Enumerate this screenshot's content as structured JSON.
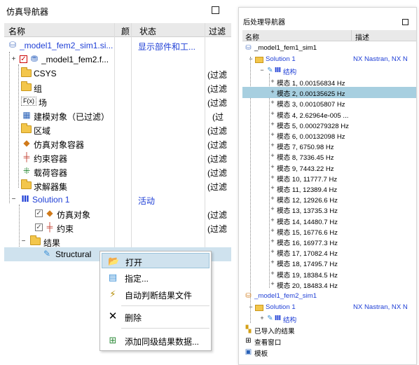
{
  "left": {
    "title": "仿真导航器",
    "columns": [
      "名称",
      "颜",
      "状态",
      "过滤"
    ],
    "rows": [
      {
        "name": "_model1_fem2_sim1.si...",
        "status": "显示部件和工...",
        "filter": ""
      },
      {
        "name": "_model1_fem2.f...",
        "status": "",
        "filter": ""
      },
      {
        "name": "CSYS",
        "status": "",
        "filter": "(过滤"
      },
      {
        "name": "组",
        "status": "",
        "filter": "(过滤"
      },
      {
        "name": "场",
        "status": "",
        "filter": "(过滤"
      },
      {
        "name": "建模对象（已过滤）",
        "status": "",
        "filter": "(过"
      },
      {
        "name": "区域",
        "status": "",
        "filter": "(过滤"
      },
      {
        "name": "仿真对象容器",
        "status": "",
        "filter": "(过滤"
      },
      {
        "name": "约束容器",
        "status": "",
        "filter": "(过滤"
      },
      {
        "name": "载荷容器",
        "status": "",
        "filter": "(过滤"
      },
      {
        "name": "求解器集",
        "status": "",
        "filter": "(过滤"
      },
      {
        "name": "Solution 1",
        "status": "活动",
        "filter": ""
      },
      {
        "name": "仿真对象",
        "status": "",
        "filter": "(过滤"
      },
      {
        "name": "约束",
        "status": "",
        "filter": "(过滤"
      },
      {
        "name": "结果",
        "status": "",
        "filter": ""
      },
      {
        "name": "Structural",
        "status": "",
        "filter": ""
      }
    ],
    "field_icon_text": "F(x)"
  },
  "menu": {
    "items": [
      {
        "label": "打开",
        "icon": "folder-open-icon"
      },
      {
        "label": "指定...",
        "icon": "specify-icon"
      },
      {
        "label": "自动判断结果文件",
        "icon": "wand-icon"
      },
      {
        "label": "删除",
        "icon": "delete-x-icon"
      },
      {
        "label": "添加同级结果数据...",
        "icon": "add-results-icon"
      }
    ]
  },
  "right": {
    "title": "后处理导航器",
    "columns": [
      "名称",
      "描述"
    ],
    "tree": {
      "sim1": "_model1_fem1_sim1",
      "solution1": "Solution 1",
      "solution1_desc": "NX Nastran, NX N",
      "structural1": "结构",
      "modes": [
        "模态 1, 0.00156834 Hz",
        "模态 2, 0.00135625 Hz",
        "模态 3, 0.00105807 Hz",
        "模态 4, 2.62964e-005 ...",
        "模态 5, 0.000279328 Hz",
        "模态 6, 0.00132098 Hz",
        "模态 7, 6750.98 Hz",
        "模态 8, 7336.45 Hz",
        "模态 9, 7443.22 Hz",
        "模态 10, 11777.7 Hz",
        "模态 11, 12389.4 Hz",
        "模态 12, 12926.6 Hz",
        "模态 13, 13735.3 Hz",
        "模态 14, 14480.7 Hz",
        "模态 15, 16776.6 Hz",
        "模态 16, 16977.3 Hz",
        "模态 17, 17082.4 Hz",
        "模态 18, 17495.7 Hz",
        "模态 19, 18384.5 Hz",
        "模态 20, 18483.4 Hz"
      ],
      "sim2": "_model1_fem2_sim1",
      "solution2": "Solution 1",
      "solution2_desc": "NX Nastran, NX N",
      "structural2": "结构",
      "imported": "已导入的结果",
      "viewport": "查看窗口",
      "template": "模板"
    }
  },
  "colors": {
    "link_blue": "#1f3fd6",
    "selection": "#a7cfe0",
    "menu_highlight": "#cfe2ee"
  }
}
